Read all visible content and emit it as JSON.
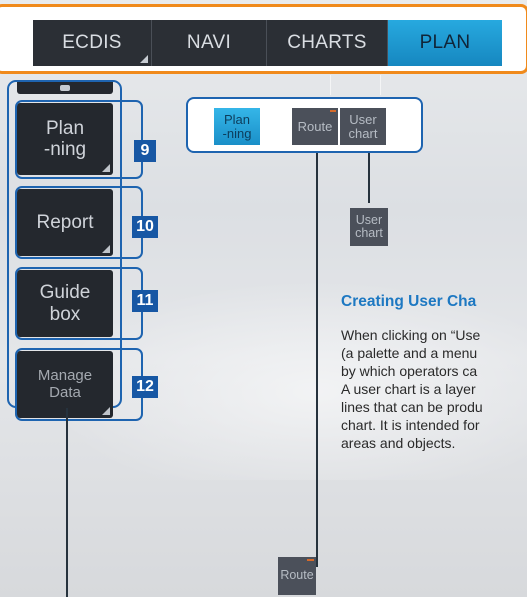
{
  "top_tabs": [
    {
      "label": "ECDIS",
      "active": false
    },
    {
      "label": "NAVI",
      "active": false
    },
    {
      "label": "CHARTS",
      "active": false
    },
    {
      "label": "PLAN",
      "active": true
    }
  ],
  "left_buttons": [
    {
      "label_lines": [
        "Plan",
        "-ning"
      ],
      "badge": "9"
    },
    {
      "label_lines": [
        "Report"
      ],
      "badge": "10"
    },
    {
      "label_lines": [
        "Guide",
        "box"
      ],
      "badge": "11"
    },
    {
      "label_lines": [
        "Manage",
        "Data"
      ],
      "badge": "12"
    }
  ],
  "sub_group": {
    "badge": "9",
    "buttons": [
      {
        "label_lines": [
          "Plan",
          "-ning"
        ],
        "active": true
      },
      {
        "label_lines": [
          "Route"
        ],
        "active": false
      },
      {
        "label_lines": [
          "User",
          "chart"
        ],
        "active": false
      }
    ]
  },
  "user_chart_button": {
    "label_lines": [
      "User",
      "chart"
    ]
  },
  "route_button": {
    "label": "Route"
  },
  "description": {
    "heading": "Creating User Cha",
    "lines": [
      "When clicking on “Use",
      "(a palette and a menu",
      "by which operators ca",
      "A user chart is a layer",
      "lines that can be produ",
      "chart. It is intended for",
      "areas and objects."
    ]
  },
  "colors": {
    "accent_orange": "#f08a1c",
    "callout_blue": "#1e64b0",
    "active_blue": "#1a9ad4",
    "button_dark": "#24282e",
    "heading_blue": "#1d78c2"
  }
}
